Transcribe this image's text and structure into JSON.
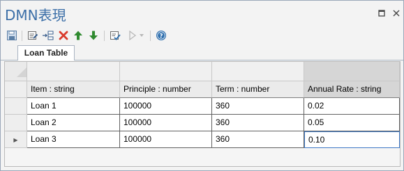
{
  "window": {
    "title": "DMN表現",
    "buttons": [
      {
        "name": "pin-icon",
        "glyph": "▫"
      },
      {
        "name": "close-icon",
        "glyph": "✕"
      }
    ]
  },
  "toolbar": {
    "items": [
      {
        "name": "save-icon",
        "color": "#5b7fa6"
      },
      {
        "name": "edit-table-icon",
        "color": "#6b6b6b"
      },
      {
        "name": "insert-column-icon",
        "color": "#3a5f8e"
      },
      {
        "name": "delete-icon",
        "color": "#d93a2b"
      },
      {
        "name": "move-up-icon",
        "color": "#2f8a2f"
      },
      {
        "name": "move-down-icon",
        "color": "#2f8a2f"
      },
      {
        "name": "validate-icon",
        "color": "#6b6b6b"
      },
      {
        "name": "run-icon",
        "color": "#b8b8b8"
      },
      {
        "name": "help-icon",
        "color": "#2f6fae"
      }
    ]
  },
  "tabs": [
    {
      "label": "Loan Table",
      "active": true
    }
  ],
  "table": {
    "columns": [
      {
        "header": "Item : string"
      },
      {
        "header": "Principle : number"
      },
      {
        "header": "Term : number"
      },
      {
        "header": "Annual Rate : string"
      }
    ],
    "rows": [
      {
        "cells": [
          "Loan 1",
          "100000",
          "360",
          "0.02"
        ],
        "current": false
      },
      {
        "cells": [
          "Loan 2",
          "100000",
          "360",
          "0.05"
        ],
        "current": false
      },
      {
        "cells": [
          "Loan 3",
          "100000",
          "360",
          "0.10"
        ],
        "current": true
      }
    ],
    "selected_column": 3,
    "row_indicator_glyph": "▶"
  }
}
